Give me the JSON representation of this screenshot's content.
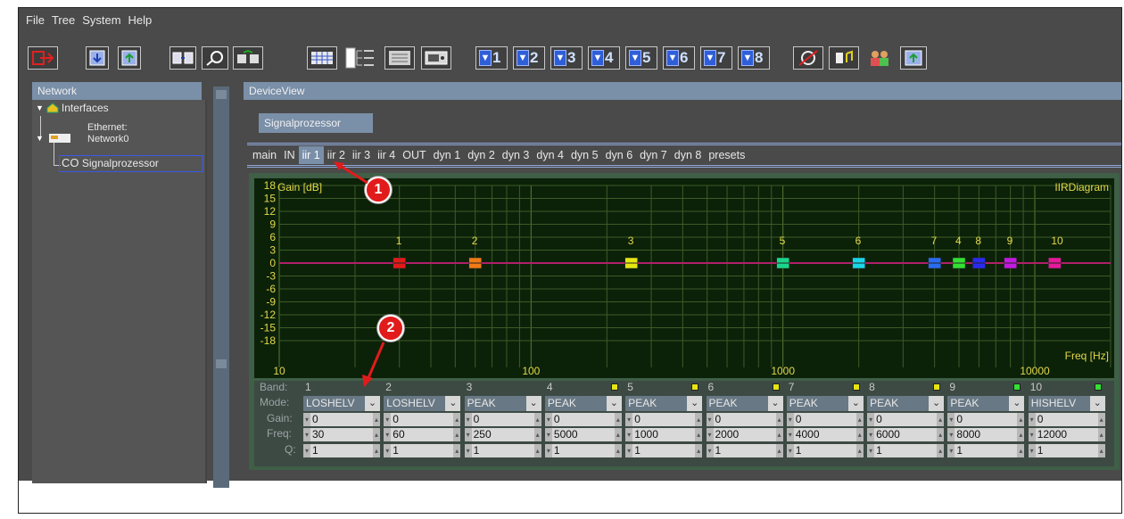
{
  "menu": [
    "File",
    "Tree",
    "System",
    "Help"
  ],
  "toolbar": {
    "preset_buttons": [
      "1",
      "2",
      "3",
      "4",
      "5",
      "6",
      "7",
      "8"
    ],
    "icons": [
      "exit-icon",
      "download-icon",
      "upload-icon",
      "connect-icon",
      "search-device-icon",
      "transfer-icon",
      "grid-view-icon",
      "tree-view-icon",
      "list-view-icon",
      "device-icon",
      "mute-off-icon",
      "audio-icon",
      "users-icon",
      "upload-device-icon"
    ]
  },
  "network": {
    "title": "Network",
    "interfaces_label": "Interfaces",
    "ethernet_label": "Ethernet:",
    "network_label": "Network0",
    "co_label": "CO",
    "device_label": "Signalprozessor"
  },
  "deviceview": {
    "title": "DeviceView",
    "subtab": "Signalprozessor",
    "tabs": [
      "main",
      "IN",
      "iir 1",
      "iir 2",
      "iir 3",
      "iir 4",
      "OUT",
      "dyn 1",
      "dyn 2",
      "dyn 3",
      "dyn 4",
      "dyn 5",
      "dyn 6",
      "dyn 7",
      "dyn 8",
      "presets"
    ],
    "active_tab": "iir 1"
  },
  "chart_data": {
    "type": "scatter",
    "title": "IIRDiagram",
    "ylabel": "Gain [dB]",
    "xlabel": "Freq [Hz]",
    "x_scale": "log",
    "xlim": [
      10,
      20000
    ],
    "ylim": [
      -18,
      18
    ],
    "y_ticks": [
      "18",
      "15",
      "12",
      "9",
      "6",
      "3",
      "0",
      "-3",
      "-6",
      "-9",
      "-12",
      "-15",
      "-18"
    ],
    "x_ticks": [
      "10",
      "100",
      "1000",
      "10000"
    ],
    "points": [
      {
        "band": "1",
        "freq": 30,
        "gain": 0,
        "color": "#e01a1a"
      },
      {
        "band": "2",
        "freq": 60,
        "gain": 0,
        "color": "#f07a14"
      },
      {
        "band": "3",
        "freq": 250,
        "gain": 0,
        "color": "#e5e512"
      },
      {
        "band": "4",
        "freq": 5000,
        "gain": 0,
        "color": "#33e033"
      },
      {
        "band": "5",
        "freq": 1000,
        "gain": 0,
        "color": "#1ad68a"
      },
      {
        "band": "6",
        "freq": 2000,
        "gain": 0,
        "color": "#19d6e8"
      },
      {
        "band": "7",
        "freq": 4000,
        "gain": 0,
        "color": "#2a6cf0"
      },
      {
        "band": "8",
        "freq": 6000,
        "gain": 0,
        "color": "#2a2af0"
      },
      {
        "band": "9",
        "freq": 8000,
        "gain": 0,
        "color": "#c21adf"
      },
      {
        "band": "10",
        "freq": 12000,
        "gain": 0,
        "color": "#e41a9a"
      }
    ],
    "line_color": "#b0206a"
  },
  "bands": {
    "labels": {
      "band": "Band:",
      "mode": "Mode:",
      "gain": "Gain:",
      "freq": "Freq:",
      "q": "Q:"
    },
    "items": [
      {
        "no": "1",
        "mode": "LOSHELV",
        "gain": "0",
        "freq": "30",
        "q": "1",
        "led": ""
      },
      {
        "no": "2",
        "mode": "LOSHELV",
        "gain": "0",
        "freq": "60",
        "q": "1",
        "led": ""
      },
      {
        "no": "3",
        "mode": "PEAK",
        "gain": "0",
        "freq": "250",
        "q": "1",
        "led": ""
      },
      {
        "no": "4",
        "mode": "PEAK",
        "gain": "0",
        "freq": "5000",
        "q": "1",
        "led": "#e5e512"
      },
      {
        "no": "5",
        "mode": "PEAK",
        "gain": "0",
        "freq": "1000",
        "q": "1",
        "led": "#e5e512"
      },
      {
        "no": "6",
        "mode": "PEAK",
        "gain": "0",
        "freq": "2000",
        "q": "1",
        "led": "#e5e512"
      },
      {
        "no": "7",
        "mode": "PEAK",
        "gain": "0",
        "freq": "4000",
        "q": "1",
        "led": "#e5e512"
      },
      {
        "no": "8",
        "mode": "PEAK",
        "gain": "0",
        "freq": "6000",
        "q": "1",
        "led": "#e5e512"
      },
      {
        "no": "9",
        "mode": "PEAK",
        "gain": "0",
        "freq": "8000",
        "q": "1",
        "led": "#33e033"
      },
      {
        "no": "10",
        "mode": "HISHELV",
        "gain": "0",
        "freq": "12000",
        "q": "1",
        "led": "#33e033"
      }
    ]
  },
  "annotations": [
    "1",
    "2"
  ]
}
